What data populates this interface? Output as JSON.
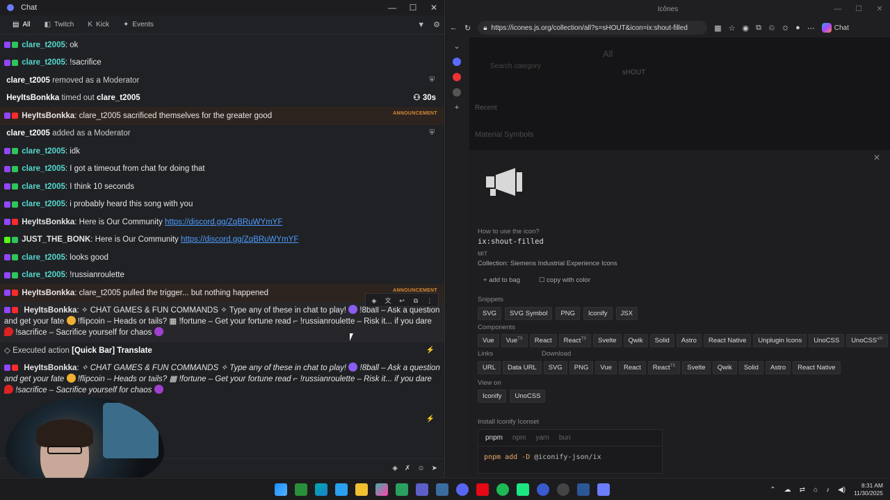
{
  "chat": {
    "window_title": "Chat",
    "tabs": [
      {
        "label": "All",
        "icon": "all-icon"
      },
      {
        "label": "Twitch",
        "icon": "twitch-icon"
      },
      {
        "label": "Kick",
        "icon": "kick-icon"
      },
      {
        "label": "Events",
        "icon": "events-icon"
      }
    ],
    "messages": [
      {
        "user": "clare_t2005",
        "text": "ok"
      },
      {
        "user": "clare_t2005",
        "text": "!sacrifice"
      },
      {
        "sys_user": "clare_t2005",
        "sys_text": "removed as a Moderator"
      },
      {
        "sys_user": "HeyItsBonkka",
        "sys_text": "timed out",
        "sys_target": "clare_t2005",
        "duration": "30s"
      },
      {
        "user": "HeyItsBonkka",
        "text": "clare_t2005 sacrificed themselves for the greater good",
        "tag": "ANNOUNCEMENT"
      },
      {
        "sys_user": "clare_t2005",
        "sys_text": "added as a Moderator"
      },
      {
        "user": "clare_t2005",
        "text": "idk"
      },
      {
        "user": "clare_t2005",
        "text": "I got a timeout from chat for doing that"
      },
      {
        "user": "clare_t2005",
        "text": "I think 10 seconds"
      },
      {
        "user": "clare_t2005",
        "text": "i probably heard this song with you"
      },
      {
        "user": "HeyItsBonkka",
        "text": "Here is Our Community",
        "link": "https://discord.gg/ZqBRuWYmYF"
      },
      {
        "user": "JUST_THE_BONK",
        "text": "Here is Our Community",
        "link": "https://discord.gg/ZqBRuWYmYF"
      },
      {
        "user": "clare_t2005",
        "text": "looks good"
      },
      {
        "user": "clare_t2005",
        "text": "!russianroulette"
      },
      {
        "user": "HeyItsBonkka",
        "text": "clare_t2005 pulled the trigger... but nothing happened",
        "tag": "ANNOUNCEMENT"
      }
    ],
    "long_message": {
      "user": "HeyItsBonkka",
      "p1": "CHAT GAMES & FUN COMMANDS",
      "p2": "Type any of these in chat to play!",
      "p3": "!8ball – Ask a question and get your fate",
      "p4": "!flipcoin – Heads or tails?",
      "p5": "!fortune – Get your fortune read",
      "p6": "!russianroulette – Risk it... if you dare",
      "p7": "!sacrifice – Sacrifice yourself for chaos"
    },
    "executed": {
      "prefix": "Executed action",
      "action": "[Quick Bar] Translate"
    }
  },
  "browser": {
    "tab_title": "Icônes",
    "url": "https://icones.js.org/collection/all?s=sHOUT&icon=ix:shout-filled",
    "copilot_label": "Chat",
    "page": {
      "all_heading": "All",
      "search_category_placeholder": "Search category",
      "search_value": "sHOUT",
      "recent": "Recent",
      "material_symbols": "Material Symbols",
      "howto": "How to use the icon?",
      "icon_id": "ix:shout-filled",
      "license": "MIT",
      "collection": "Collection: Siemens Industrial Experience Icons",
      "add_to_bag": "add to bag",
      "copy_with_color": "copy with color",
      "snippets_label": "Snippets",
      "snippets": [
        "SVG",
        "SVG Symbol",
        "PNG",
        "Iconify",
        "JSX"
      ],
      "components_label": "Components",
      "components": [
        "Vue",
        "Vue",
        "React",
        "React",
        "Svelte",
        "Qwik",
        "Solid",
        "Astro",
        "React Native",
        "Unplugin Icons",
        "UnoCSS",
        "UnoCSS"
      ],
      "links_label": "Links",
      "links": [
        "URL",
        "Data URL"
      ],
      "download_label": "Download",
      "download": [
        "SVG",
        "PNG",
        "Vue",
        "React",
        "React",
        "Svelte",
        "Qwik",
        "Solid",
        "Astro",
        "React Native"
      ],
      "viewon_label": "View on",
      "viewon": [
        "Iconify",
        "UnoCSS"
      ],
      "install_label": "Install Iconify Iconset",
      "pkg_tabs": [
        "pnpm",
        "npm",
        "yarn",
        "bun"
      ],
      "install_cmd": "pnpm add -D",
      "install_pkg": "@iconify-json/ix"
    }
  },
  "taskbar": {
    "time": "8:31 AM",
    "date": "11/30/2025"
  }
}
